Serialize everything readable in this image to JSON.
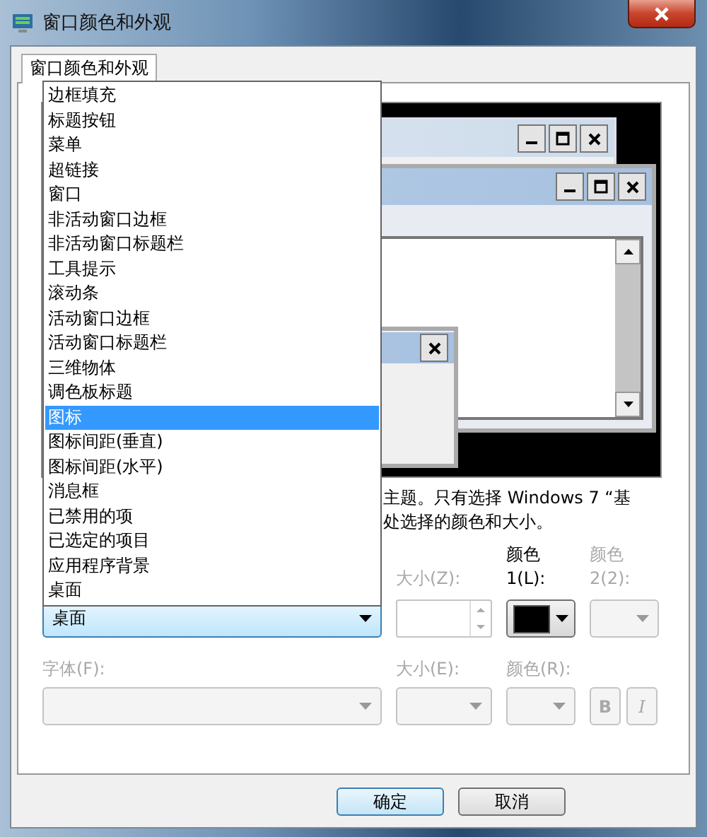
{
  "window": {
    "title": "窗口颜色和外观"
  },
  "tabs": [
    {
      "label": "窗口颜色和外观",
      "selected": true
    }
  ],
  "item_list": {
    "items": [
      {
        "label": "边框填充",
        "selected": false
      },
      {
        "label": "标题按钮",
        "selected": false
      },
      {
        "label": "菜单",
        "selected": false
      },
      {
        "label": "超链接",
        "selected": false
      },
      {
        "label": "窗口",
        "selected": false
      },
      {
        "label": "非活动窗口边框",
        "selected": false
      },
      {
        "label": "非活动窗口标题栏",
        "selected": false
      },
      {
        "label": "工具提示",
        "selected": false
      },
      {
        "label": "滚动条",
        "selected": false
      },
      {
        "label": "活动窗口边框",
        "selected": false
      },
      {
        "label": "活动窗口标题栏",
        "selected": false
      },
      {
        "label": "三维物体",
        "selected": false
      },
      {
        "label": "调色板标题",
        "selected": false
      },
      {
        "label": "图标",
        "selected": true
      },
      {
        "label": "图标间距(垂直)",
        "selected": false
      },
      {
        "label": "图标间距(水平)",
        "selected": false
      },
      {
        "label": "消息框",
        "selected": false
      },
      {
        "label": "已禁用的项",
        "selected": false
      },
      {
        "label": "已选定的项目",
        "selected": false
      },
      {
        "label": "应用程序背景",
        "selected": false
      },
      {
        "label": "桌面",
        "selected": false
      }
    ]
  },
  "description": [
    "主题。只有选择 Windows 7 “基",
    "处选择的颜色和大小。"
  ],
  "item_combo": {
    "value": "桌面"
  },
  "item_size": {
    "label": "大小(Z):",
    "disabled": true
  },
  "color_1": {
    "label": "颜色 1(L):",
    "disabled": false,
    "color": "#000000"
  },
  "color_2": {
    "label": "颜色 2(2):",
    "disabled": true
  },
  "font": {
    "label": "字体(F):",
    "disabled": true
  },
  "font_size": {
    "label": "大小(E):",
    "disabled": true
  },
  "font_color": {
    "label": "颜色(R):",
    "disabled": true
  },
  "bold_button": {
    "label": "B",
    "disabled": true
  },
  "italic_button": {
    "label": "I",
    "disabled": true
  },
  "buttons": [
    {
      "label": "确定",
      "default": true
    },
    {
      "label": "取消",
      "default": false
    }
  ]
}
